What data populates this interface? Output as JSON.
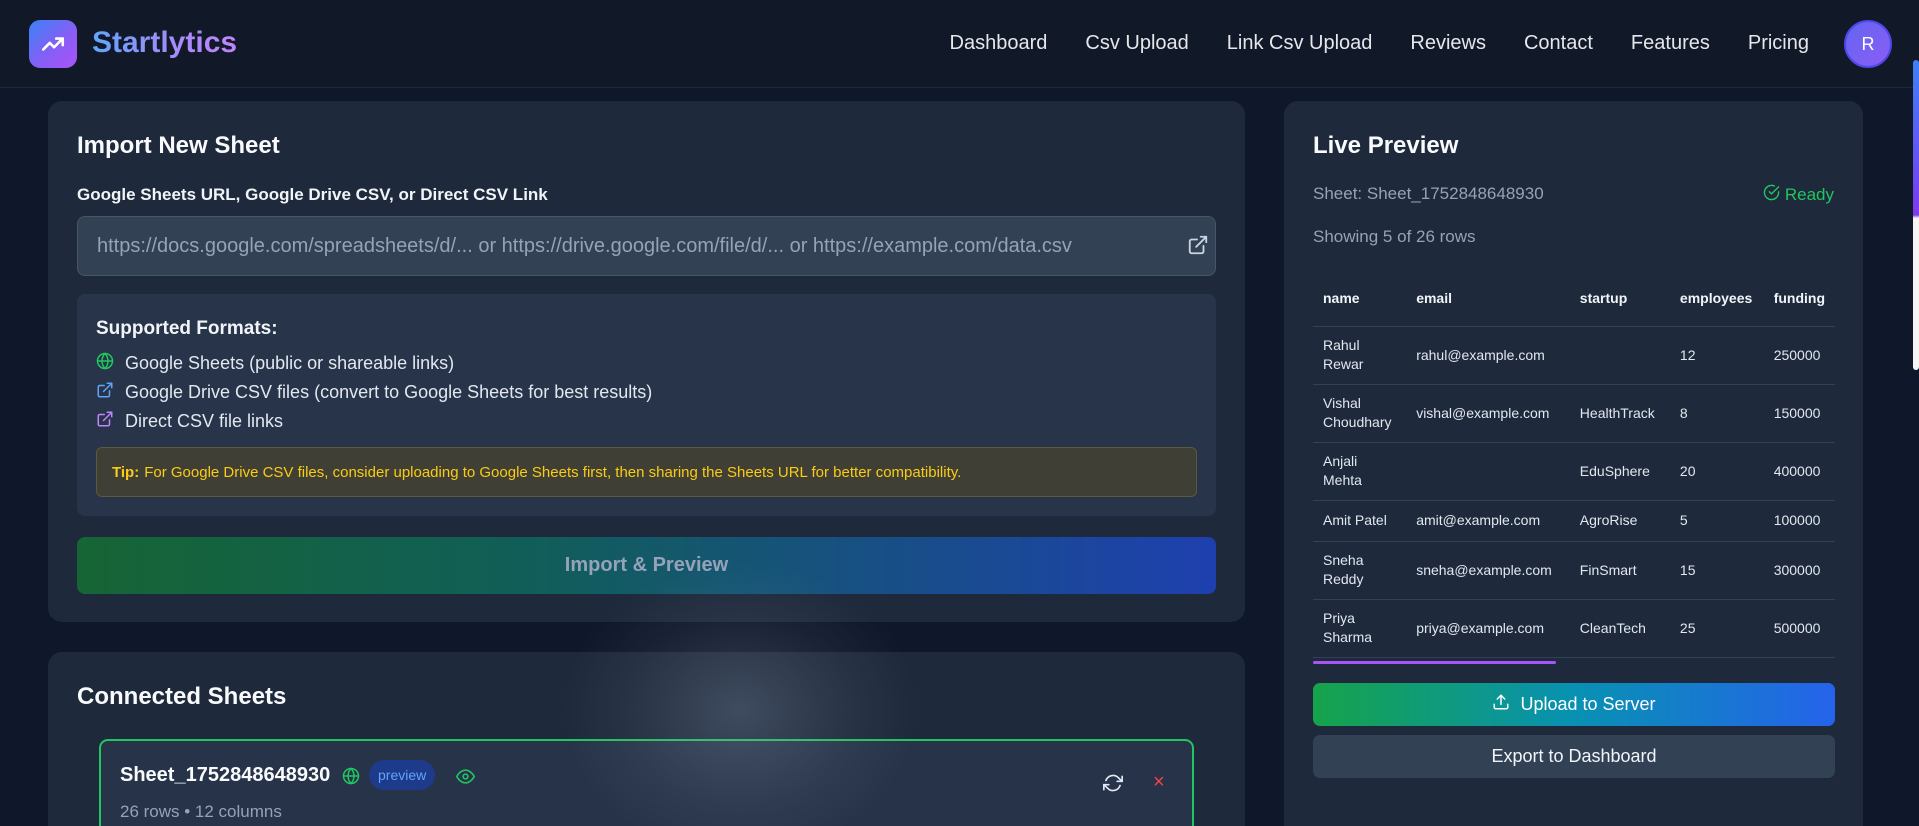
{
  "nav": {
    "brand": "Startlytics",
    "links": [
      "Dashboard",
      "Csv Upload",
      "Link Csv Upload",
      "Reviews",
      "Contact",
      "Features",
      "Pricing"
    ],
    "avatar_initial": "R"
  },
  "import": {
    "title": "Import New Sheet",
    "field_label": "Google Sheets URL, Google Drive CSV, or Direct CSV Link",
    "url_placeholder": "https://docs.google.com/spreadsheets/d/... or https://drive.google.com/file/d/... or https://example.com/data.csv",
    "formats_title": "Supported Formats:",
    "formats": [
      {
        "icon": "globe-icon",
        "text": "Google Sheets (public or shareable links)"
      },
      {
        "icon": "external-link-icon",
        "text": "Google Drive CSV files (convert to Google Sheets for best results)"
      },
      {
        "icon": "external-link-icon",
        "text": "Direct CSV file links"
      }
    ],
    "tip_label": "Tip:",
    "tip_text": "For Google Drive CSV files, consider uploading to Google Sheets first, then sharing the Sheets URL for better compatibility.",
    "button": "Import & Preview"
  },
  "connected": {
    "title": "Connected Sheets",
    "sheet": {
      "name": "Sheet_1752848648930",
      "badge": "preview",
      "meta": "26 rows • 12 columns",
      "remove": "×"
    }
  },
  "preview": {
    "title": "Live Preview",
    "sheet_label": "Sheet: Sheet_1752848648930",
    "status": "Ready",
    "row_count": "Showing 5 of 26 rows",
    "columns": [
      "name",
      "email",
      "startup",
      "employees",
      "funding"
    ],
    "rows": [
      [
        "Rahul Rewar",
        "rahul@example.com",
        "",
        "12",
        "250000"
      ],
      [
        "Vishal Choudhary",
        "vishal@example.com",
        "HealthTrack",
        "8",
        "150000"
      ],
      [
        "Anjali Mehta",
        "",
        "EduSphere",
        "20",
        "400000"
      ],
      [
        "Amit Patel",
        "amit@example.com",
        "AgroRise",
        "5",
        "100000"
      ],
      [
        "Sneha Reddy",
        "sneha@example.com",
        "FinSmart",
        "15",
        "300000"
      ],
      [
        "Priya Sharma",
        "priya@example.com",
        "CleanTech",
        "25",
        "500000"
      ]
    ],
    "upload_button": "Upload to Server",
    "export_button": "Export to Dashboard"
  },
  "colors": {
    "accent_green": "#22c55e",
    "accent_blue": "#2563eb",
    "tip_yellow": "#facc15",
    "danger": "#ef4444"
  }
}
